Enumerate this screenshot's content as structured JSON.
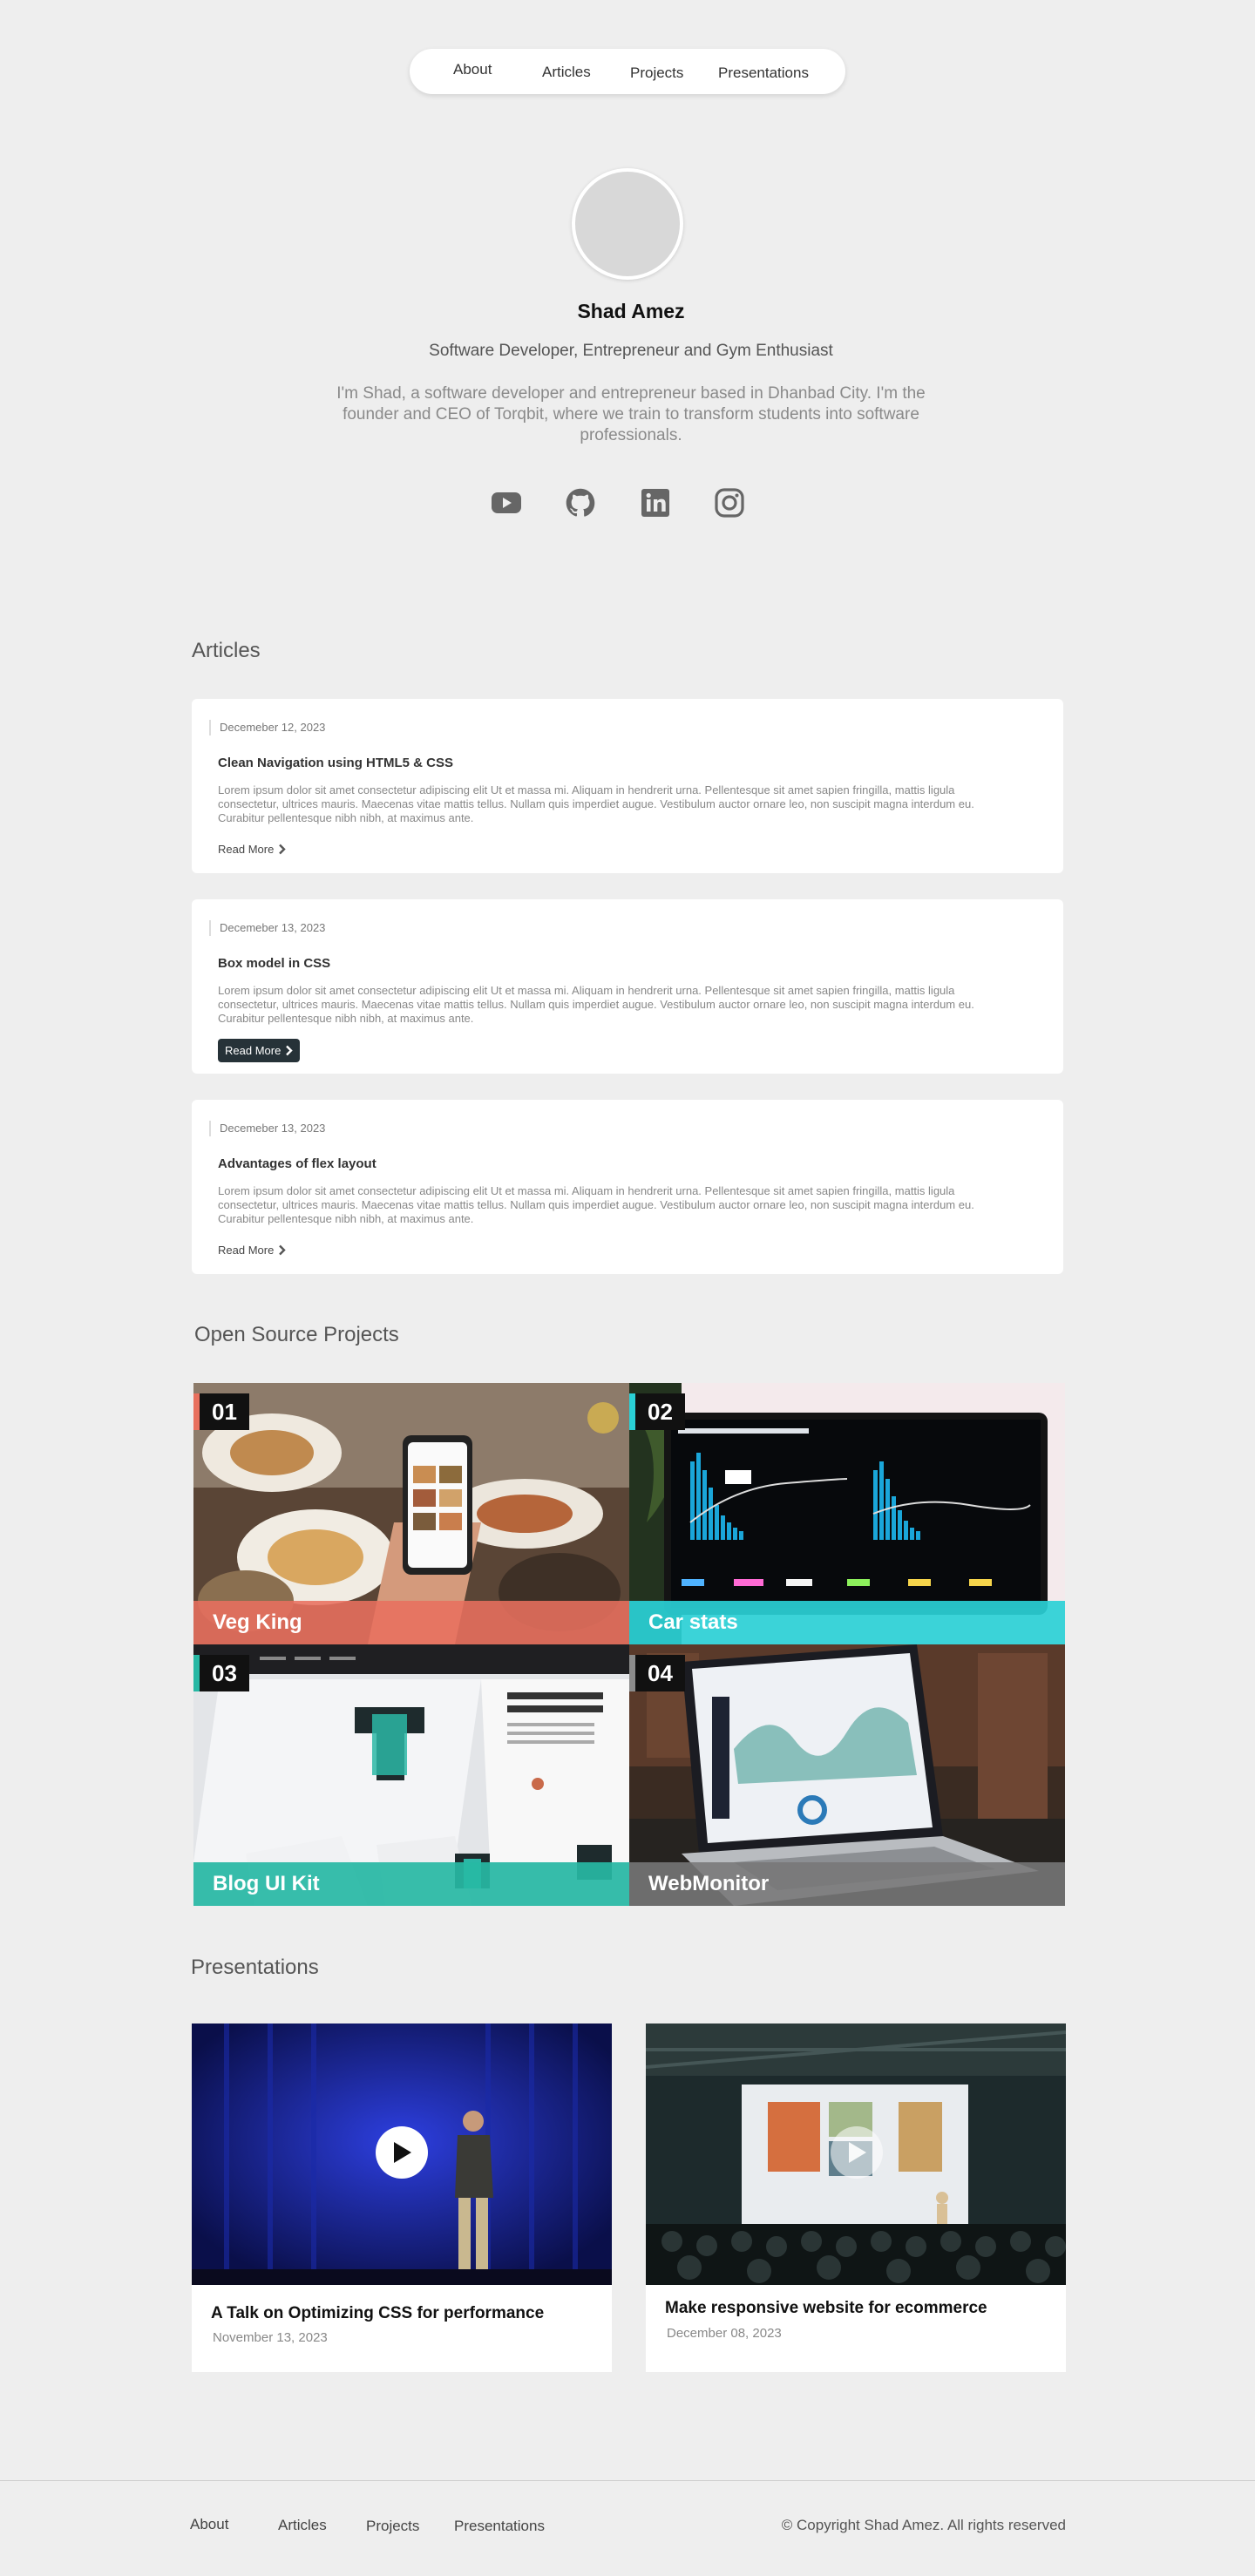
{
  "nav": {
    "items": [
      "About",
      "Articles",
      "Projects",
      "Presentations"
    ]
  },
  "profile": {
    "name": "Shad Amez",
    "tagline": "Software Developer, Entrepreneur and Gym Enthusiast",
    "bio": "I'm Shad, a software developer and entrepreneur based in Dhanbad City. I'm the founder and CEO of Torqbit, where we train to transform students into software professionals.",
    "socials": [
      "youtube-icon",
      "github-icon",
      "linkedin-icon",
      "instagram-icon"
    ]
  },
  "articles": {
    "heading": "Articles",
    "read_more": "Read More",
    "items": [
      {
        "date": "Decemeber 12, 2023",
        "title": "Clean Navigation using HTML5 & CSS",
        "excerpt": "Lorem ipsum dolor sit amet consectetur adipiscing elit Ut et massa mi. Aliquam in hendrerit urna. Pellentesque sit amet sapien fringilla, mattis ligula consectetur, ultrices mauris. Maecenas vitae mattis tellus. Nullam quis imperdiet augue. Vestibulum auctor ornare leo, non suscipit magna interdum eu. Curabitur pellentesque nibh nibh, at maximus ante."
      },
      {
        "date": "Decemeber 13, 2023",
        "title": "Box model in CSS",
        "excerpt": "Lorem ipsum dolor sit amet consectetur adipiscing elit Ut et massa mi. Aliquam in hendrerit urna. Pellentesque sit amet sapien fringilla, mattis ligula consectetur, ultrices mauris. Maecenas vitae mattis tellus. Nullam quis imperdiet augue. Vestibulum auctor ornare leo, non suscipit magna interdum eu. Curabitur pellentesque nibh nibh, at maximus ante."
      },
      {
        "date": "Decemeber 13, 2023",
        "title": "Advantages of flex layout",
        "excerpt": "Lorem ipsum dolor sit amet consectetur adipiscing elit Ut et massa mi. Aliquam in hendrerit urna. Pellentesque sit amet sapien fringilla, mattis ligula consectetur, ultrices mauris. Maecenas vitae mattis tellus. Nullam quis imperdiet augue. Vestibulum auctor ornare leo, non suscipit magna interdum eu. Curabitur pellentesque nibh nibh, at maximus ante."
      }
    ]
  },
  "projects": {
    "heading": "Open Source Projects",
    "items": [
      {
        "number": "01",
        "name": "Veg King",
        "accent": "#e8705e"
      },
      {
        "number": "02",
        "name": "Car stats",
        "accent": "#2ad0d6"
      },
      {
        "number": "03",
        "name": "Blog UI Kit",
        "accent": "#27b8a4"
      },
      {
        "number": "04",
        "name": "WebMonitor",
        "accent": "#8c8c8c"
      }
    ]
  },
  "presentations": {
    "heading": "Presentations",
    "items": [
      {
        "title": "A Talk on Optimizing CSS for performance",
        "date": "November 13, 2023"
      },
      {
        "title": "Make responsive website for ecommerce",
        "date": "December 08, 2023"
      }
    ]
  },
  "footer": {
    "links": [
      "About",
      "Articles",
      "Projects",
      "Presentations"
    ],
    "copyright": "© Copyright Shad Amez. All rights reserved"
  }
}
